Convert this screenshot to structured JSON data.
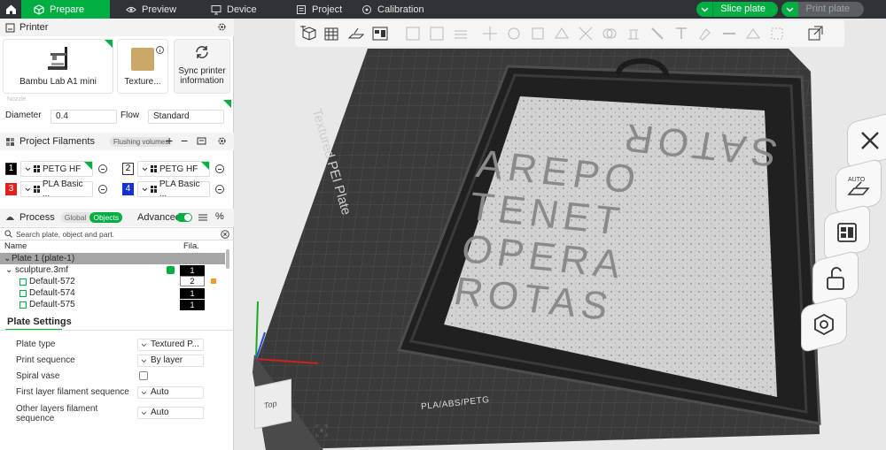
{
  "colors": {
    "accent": "#00ae42",
    "topbar": "#2f3337",
    "plate": "#3c3c3c"
  },
  "topbar": {
    "tabs": [
      {
        "label": "Prepare",
        "icon": "cube-icon"
      },
      {
        "label": "Preview",
        "icon": "eye-icon"
      },
      {
        "label": "Device",
        "icon": "monitor-icon"
      },
      {
        "label": "Project",
        "icon": "project-icon"
      },
      {
        "label": "Calibration",
        "icon": "calibration-icon"
      }
    ],
    "slice_label": "Slice plate",
    "print_label": "Print plate"
  },
  "printer": {
    "header": "Printer",
    "name": "Bambu Lab A1 mini",
    "plate_label": "Texture...",
    "sync_label_1": "Sync printer",
    "sync_label_2": "information",
    "nozzle_label": "Nozzle",
    "diameter_label": "Diameter",
    "diameter_value": "0.4",
    "flow_label": "Flow",
    "flow_value": "Standard"
  },
  "filaments": {
    "header": "Project Filaments",
    "flushing_label": "Flushing volumes",
    "items": [
      {
        "num": "1",
        "name": "PETG HF",
        "color": "#000000",
        "text": "#ffffff"
      },
      {
        "num": "2",
        "name": "PETG HF",
        "color": "#ffffff",
        "text": "#000000"
      },
      {
        "num": "3",
        "name": "PLA Basic ...",
        "color": "#e5201c",
        "text": "#ffffff"
      },
      {
        "num": "4",
        "name": "PLA Basic ...",
        "color": "#1530d8",
        "text": "#ffffff"
      }
    ]
  },
  "process": {
    "header": "Process",
    "global_label": "Global",
    "objects_label": "Objects",
    "advanced_label": "Advanced",
    "search_placeholder": "Search plate, object and part."
  },
  "tree": {
    "col_name": "Name",
    "col_fila": "Fila.",
    "plate": "Plate 1 (plate-1)",
    "object": "sculpture.3mf",
    "object_fila": "1",
    "parts": [
      {
        "name": "Default-572",
        "fila": "2"
      },
      {
        "name": "Default-574",
        "fila": "1"
      },
      {
        "name": "Default-575",
        "fila": "1"
      }
    ]
  },
  "plate_settings": {
    "header": "Plate Settings",
    "rows": [
      {
        "label": "Plate type",
        "value": "Textured P..."
      },
      {
        "label": "Print sequence",
        "value": "By layer"
      },
      {
        "label": "Spiral vase",
        "value": ""
      },
      {
        "label": "First layer filament sequence",
        "value": "Auto"
      },
      {
        "label": "Other layers filament",
        "label2": "sequence",
        "value": "Auto"
      }
    ]
  },
  "viewport": {
    "plate_label": "Textured PEI Plate",
    "plate_footer": "PLA/ABS/PETG",
    "view_cube_label": "Top",
    "sculpture_rows": [
      "SATOR",
      "AREPO",
      "TENET",
      "OPERA",
      "ROTAS"
    ]
  }
}
